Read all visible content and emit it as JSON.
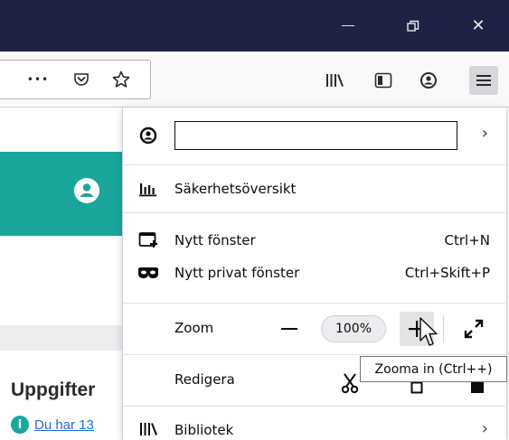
{
  "window": {
    "controls": [
      {
        "name": "minimize-button",
        "icon": "minimize-icon"
      },
      {
        "name": "restore-button",
        "icon": "restore-icon",
        "glyph": "❐"
      },
      {
        "name": "close-button",
        "icon": "close-icon",
        "glyph": "✕"
      }
    ],
    "titlebar_color": "#1f2244"
  },
  "toolbar": {
    "more_glyph": "•••",
    "pocket_icon": "pocket-icon",
    "bookmark_icon": "star-icon",
    "library_icon": "library-icon",
    "sidebar_icon": "sidebar-icon",
    "account_icon": "account-icon",
    "menu_icon": "hamburger-menu-icon"
  },
  "page": {
    "heading": "Uppgifter",
    "info_text": "Du har 13 ",
    "info_glyph": "i",
    "accent_color": "#1aa69b"
  },
  "menu": {
    "account": {
      "input_value": "",
      "chevron": "›"
    },
    "security": {
      "label": "Säkerhetsöversikt"
    },
    "new_window": {
      "label": "Nytt fönster",
      "shortcut": "Ctrl+N"
    },
    "private_window": {
      "label": "Nytt privat fönster",
      "shortcut": "Ctrl+Skift+P"
    },
    "zoom": {
      "label": "Zoom",
      "level": "100%",
      "minus": "−",
      "plus": "+"
    },
    "edit": {
      "label": "Redigera"
    },
    "library": {
      "label": "Bibliotek",
      "chevron": "›"
    }
  },
  "tooltip": {
    "text": "Zooma in (Ctrl++)"
  }
}
